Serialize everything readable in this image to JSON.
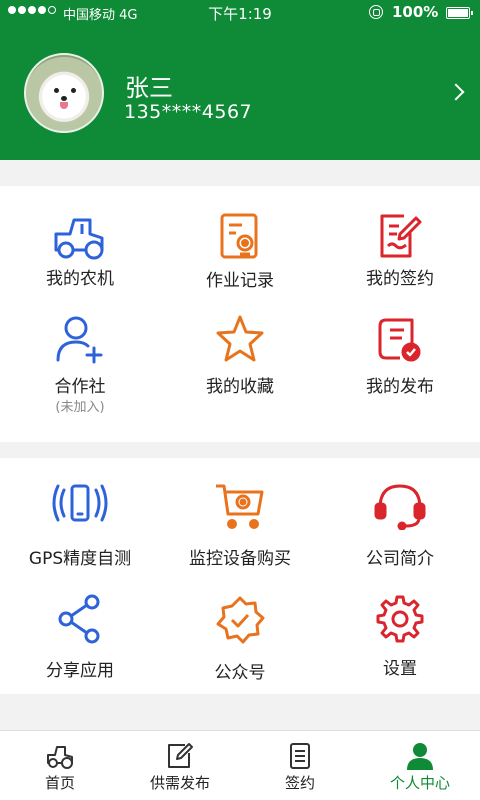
{
  "status_bar": {
    "carrier": "中国移动  4G",
    "time": "下午1:19",
    "battery": "100%"
  },
  "profile": {
    "name": "张三",
    "phone": "135****4567"
  },
  "section1": {
    "items": [
      {
        "label": "我的农机",
        "icon": "tractor-icon",
        "color": "#2e62d9"
      },
      {
        "label": "作业记录",
        "icon": "record-camera-icon",
        "color": "#e8731c"
      },
      {
        "label": "我的签约",
        "icon": "sign-contract-icon",
        "color": "#d9252b"
      },
      {
        "label": "合作社",
        "sub": "(未加入)",
        "icon": "user-add-icon",
        "color": "#2e62d9"
      },
      {
        "label": "我的收藏",
        "icon": "star-icon",
        "color": "#e8731c"
      },
      {
        "label": "我的发布",
        "icon": "publish-document-icon",
        "color": "#d9252b"
      }
    ]
  },
  "section2": {
    "items": [
      {
        "label": "GPS精度自测",
        "icon": "gps-phone-icon",
        "color": "#2e62d9"
      },
      {
        "label": "监控设备购买",
        "icon": "cart-camera-icon",
        "color": "#e8731c"
      },
      {
        "label": "公司简介",
        "icon": "headset-icon",
        "color": "#d9252b"
      },
      {
        "label": "分享应用",
        "icon": "share-icon",
        "color": "#2e62d9"
      },
      {
        "label": "公众号",
        "icon": "verified-badge-icon",
        "color": "#e8731c"
      },
      {
        "label": "设置",
        "icon": "gear-icon",
        "color": "#d9252b"
      }
    ]
  },
  "tabbar": {
    "items": [
      {
        "label": "首页",
        "icon": "home-tractor-icon"
      },
      {
        "label": "供需发布",
        "icon": "edit-icon"
      },
      {
        "label": "签约",
        "icon": "list-document-icon"
      },
      {
        "label": "个人中心",
        "icon": "person-icon",
        "active": true
      }
    ],
    "active_color": "#0f8a36"
  },
  "colors": {
    "brand_green": "#0f8a36"
  }
}
